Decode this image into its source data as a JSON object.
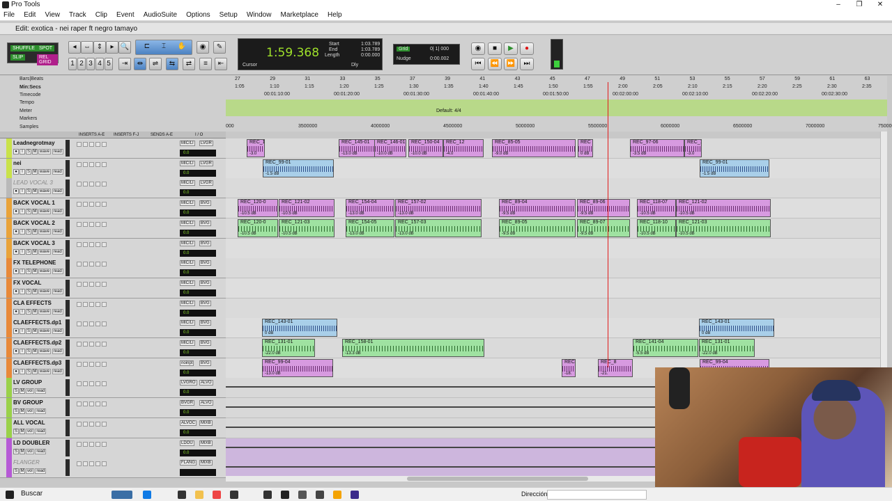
{
  "window": {
    "title": "Pro Tools",
    "edit_title": "Edit: exotica - nei raper ft negro tamayo"
  },
  "menu": [
    "File",
    "Edit",
    "View",
    "Track",
    "Clip",
    "Event",
    "AudioSuite",
    "Options",
    "Setup",
    "Window",
    "Marketplace",
    "Help"
  ],
  "modes": {
    "shuffle": "SHUFFLE",
    "spot": "SPOT",
    "slip": "SLIP",
    "grid": "REL GRID"
  },
  "counter": {
    "main": "1:59.368",
    "start_label": "Start",
    "end_label": "End",
    "length_label": "Length",
    "start": "1:03.789",
    "end": "1:03.789",
    "length": "0:00.000",
    "cursor_label": "Cursor",
    "dly": "Dly"
  },
  "grid": {
    "grid_label": "Grid",
    "grid_value": "0| 1| 000",
    "nudge_label": "Nudge",
    "nudge_value": "0:00.002"
  },
  "rulers": {
    "labels": [
      "Bars|Beats",
      "Min:Secs",
      "Timecode",
      "Tempo",
      "Meter",
      "Markers",
      "Samples"
    ],
    "bars": [
      "27",
      "29",
      "31",
      "33",
      "35",
      "37",
      "39",
      "41",
      "43",
      "45",
      "47",
      "49",
      "51",
      "53",
      "55",
      "57",
      "59",
      "61",
      "63"
    ],
    "minsecs": [
      "1:05",
      "1:10",
      "1:15",
      "1:20",
      "1:25",
      "1:30",
      "1:35",
      "1:40",
      "1:45",
      "1:50",
      "1:55",
      "2:00",
      "2:05",
      "2:10",
      "2:15",
      "2:20",
      "2:25",
      "2:30",
      "2:35"
    ],
    "timecode": [
      "00:01:10:00",
      "00:01:20:00",
      "00:01:30:00",
      "00:01:40:00",
      "00:01:50:00",
      "00:02:00:00",
      "00:02:10:00",
      "00:02:20:00",
      "00:02:30:00"
    ],
    "meter_text": "Default: 4/4",
    "samples": [
      "000",
      "3500000",
      "4000000",
      "4500000",
      "5000000",
      "5500000",
      "6000000",
      "6500000",
      "7000000",
      "750000"
    ]
  },
  "track_header": {
    "inserts_ae": "INSERTS A-E",
    "inserts_fj": "INSERTS F-J",
    "sends_ae": "SENDS A-E",
    "io": "I / O"
  },
  "tracks": [
    {
      "name": "Leadnegrotmay",
      "color": "#c9e24a",
      "io1": "MIC/LI",
      "io2": "LVGR",
      "vol": "0.0",
      "italic": false
    },
    {
      "name": "nei",
      "color": "#c9e24a",
      "io1": "MIC/LI",
      "io2": "LVGR",
      "vol": "0.0",
      "italic": false
    },
    {
      "name": "LEAD VOCAL 3",
      "color": "#b9b9b9",
      "io1": "MIC/LI",
      "io2": "LVGR",
      "vol": "0.0",
      "italic": true
    },
    {
      "name": "BACK VOCAL 1",
      "color": "#e9a33a",
      "io1": "MIC/LI",
      "io2": "BVG",
      "vol": "0.0",
      "italic": false
    },
    {
      "name": "BACK VOCAL 2",
      "color": "#e9a33a",
      "io1": "MIC/LI",
      "io2": "BVG",
      "vol": "0.0",
      "italic": false
    },
    {
      "name": "BACK VOCAL 3",
      "color": "#e9a33a",
      "io1": "MIC/LI",
      "io2": "BVG",
      "vol": "0.0",
      "italic": false
    },
    {
      "name": "FX TELEPHONE",
      "color": "#e8893a",
      "io1": "MIC/LI",
      "io2": "BVG",
      "vol": "0.0",
      "italic": false
    },
    {
      "name": "FX VOCAL",
      "color": "#e8893a",
      "io1": "MIC/LI",
      "io2": "BVG",
      "vol": "0.0",
      "italic": false
    },
    {
      "name": "CLA EFFECTS",
      "color": "#e8893a",
      "io1": "MIC/LI",
      "io2": "BVG",
      "vol": "0.0",
      "italic": false
    },
    {
      "name": "CLAEFFECTS.dp1",
      "color": "#e8893a",
      "io1": "MIC/LI",
      "io2": "BVG",
      "vol": "0.0",
      "italic": false
    },
    {
      "name": "CLAEFFECTS.dp2",
      "color": "#e8893a",
      "io1": "MIC/LI",
      "io2": "BVG",
      "vol": "0.0",
      "italic": false
    },
    {
      "name": "CLAEFFECTS.dp3",
      "color": "#e8893a",
      "io1": "noinpt",
      "io2": "BVG",
      "vol": "0.0",
      "italic": false
    },
    {
      "name": "LV GROUP",
      "color": "#9ad14a",
      "io1": "LVGRO",
      "io2": "ALVO",
      "vol": "0.0",
      "italic": false
    },
    {
      "name": "BV GROUP",
      "color": "#9ad14a",
      "io1": "BVGR",
      "io2": "ALVO",
      "vol": "0.0",
      "italic": false
    },
    {
      "name": "ALL VOCAL",
      "color": "#9ad14a",
      "io1": "ALVOC",
      "io2": "MIXB",
      "vol": "0.0",
      "italic": false
    },
    {
      "name": "LD DOUBLER",
      "color": "#b65ad6",
      "io1": "LDOU",
      "io2": "MIXB",
      "vol": "0.0",
      "italic": false
    },
    {
      "name": "FLANGER",
      "color": "#b65ad6",
      "io1": "FLANG",
      "io2": "MIXB",
      "vol": "",
      "italic": true
    }
  ],
  "track_btn_labels": {
    "rec": "●",
    "input": "I",
    "solo": "S",
    "mute": "M",
    "view": "wave",
    "read": "read",
    "vol_view": "vol"
  },
  "clips": [
    {
      "lane": 0,
      "name": "REC_1",
      "gain": "-3.0",
      "color": "pink"
    },
    {
      "lane": 0,
      "name": "REC_145-01",
      "gain": "-13.0 dB",
      "color": "pink"
    },
    {
      "lane": 0,
      "name": "REC_146-01",
      "gain": "-10.0 dB",
      "color": "pink"
    },
    {
      "lane": 0,
      "name": "REC_150-04",
      "gain": "-10.0 dB",
      "color": "pink"
    },
    {
      "lane": 0,
      "name": "REC_12",
      "gain": "-4.0",
      "color": "pink"
    },
    {
      "lane": 0,
      "name": "REC_85-05",
      "gain": "-9.0 dB",
      "color": "pink"
    },
    {
      "lane": 0,
      "name": "REC",
      "gain": "0 dB",
      "color": "pink"
    },
    {
      "lane": 0,
      "name": "REC_97-06",
      "gain": "-3.5 dB",
      "color": "pink"
    },
    {
      "lane": 0,
      "name": "REC_1",
      "gain": "-3.0",
      "color": "pink"
    },
    {
      "lane": 1,
      "name": "REC_99-01",
      "gain": "-1.5 dB",
      "color": "blue"
    },
    {
      "lane": 1,
      "name": "REC_99-01",
      "gain": "-1.5 dB",
      "color": "blue"
    },
    {
      "lane": 3,
      "name": "REC_120-0",
      "gain": "-10.5 dB",
      "color": "pink"
    },
    {
      "lane": 3,
      "name": "REC_121-02",
      "gain": "-10.5 dB",
      "color": "pink"
    },
    {
      "lane": 3,
      "name": "REC_154-04",
      "gain": "-13.0 dB",
      "color": "pink"
    },
    {
      "lane": 3,
      "name": "REC_157-02",
      "gain": "-13.0 dB",
      "color": "pink"
    },
    {
      "lane": 3,
      "name": "REC_89-04",
      "gain": "-9.5 dB",
      "color": "pink"
    },
    {
      "lane": 3,
      "name": "REC_89-06",
      "gain": "-9.5 dB",
      "color": "pink"
    },
    {
      "lane": 3,
      "name": "REC_118-07",
      "gain": "-10.5 dB",
      "color": "pink"
    },
    {
      "lane": 3,
      "name": "REC_121-02",
      "gain": "-10.5 dB",
      "color": "pink"
    },
    {
      "lane": 4,
      "name": "REC_120-0",
      "gain": "-10.5 dB",
      "color": "green"
    },
    {
      "lane": 4,
      "name": "REC_121-03",
      "gain": "-10.5 dB",
      "color": "green"
    },
    {
      "lane": 4,
      "name": "REC_154-05",
      "gain": "-13.0 dB",
      "color": "green"
    },
    {
      "lane": 4,
      "name": "REC_157-03",
      "gain": "-13.0 dB",
      "color": "green"
    },
    {
      "lane": 4,
      "name": "REC_89-05",
      "gain": "-9.5 dB",
      "color": "green"
    },
    {
      "lane": 4,
      "name": "REC_89-07",
      "gain": "-9.5 dB",
      "color": "green"
    },
    {
      "lane": 4,
      "name": "REC_118-10",
      "gain": "-10.5 dB",
      "color": "green"
    },
    {
      "lane": 4,
      "name": "REC_121-03",
      "gain": "-10.5 dB",
      "color": "green"
    },
    {
      "lane": 9,
      "name": "REC_143-01",
      "gain": "0 dB",
      "color": "blue"
    },
    {
      "lane": 9,
      "name": "REC_143-01",
      "gain": "0 dB",
      "color": "blue"
    },
    {
      "lane": 10,
      "name": "REC_131-01",
      "gain": "-22.0 dB",
      "color": "green"
    },
    {
      "lane": 10,
      "name": "REC_158-01",
      "gain": "-13.3 dB",
      "color": "green"
    },
    {
      "lane": 10,
      "name": "REC_141-04",
      "gain": "-5.5 dB",
      "color": "green"
    },
    {
      "lane": 10,
      "name": "REC_131-01",
      "gain": "-22.0 dB",
      "color": "green"
    },
    {
      "lane": 11,
      "name": "REC_99-04",
      "gain": "-13.0 dB",
      "color": "pink"
    },
    {
      "lane": 11,
      "name": "REC",
      "gain": "-18.",
      "color": "pink"
    },
    {
      "lane": 11,
      "name": "REC_8",
      "gain": "-21.",
      "color": "pink"
    },
    {
      "lane": 11,
      "name": "REC_99-04",
      "gain": "-13.0 dB",
      "color": "pink"
    }
  ],
  "taskbar": {
    "search": "Buscar",
    "address_label": "Dirección"
  }
}
